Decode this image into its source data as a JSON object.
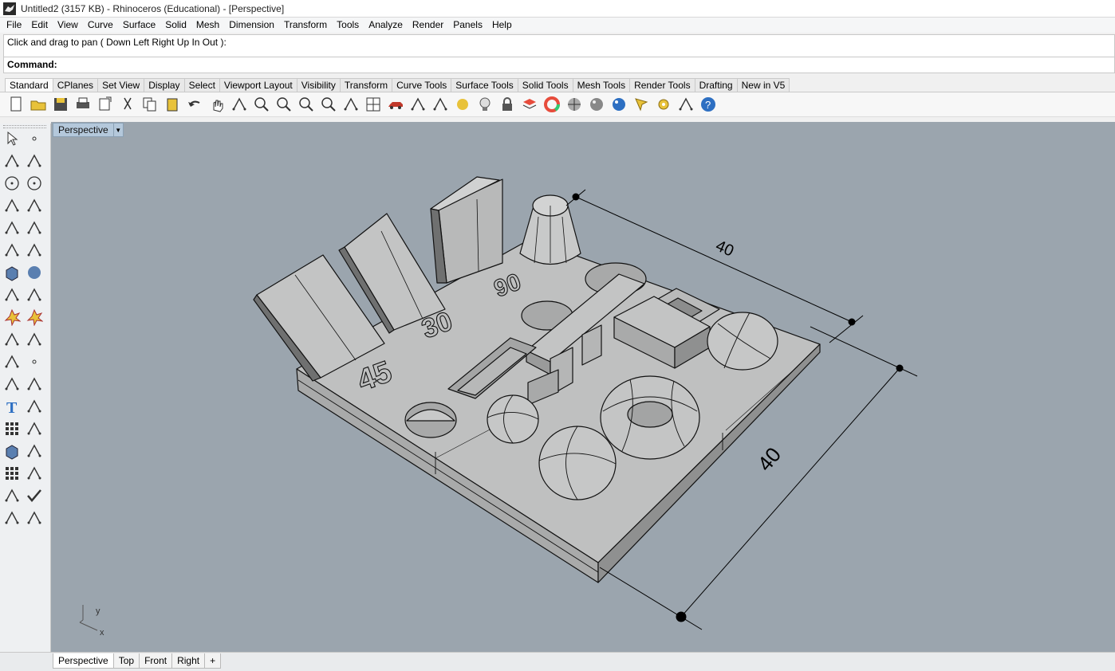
{
  "window": {
    "title": "Untitled2 (3157 KB) - Rhinoceros (Educational) - [Perspective]"
  },
  "menu": [
    "File",
    "Edit",
    "View",
    "Curve",
    "Surface",
    "Solid",
    "Mesh",
    "Dimension",
    "Transform",
    "Tools",
    "Analyze",
    "Render",
    "Panels",
    "Help"
  ],
  "command": {
    "history": "Click and drag to pan ( Down  Left  Right  Up  In  Out ):",
    "prompt": "Command:"
  },
  "toolbar_tabs": [
    "Standard",
    "CPlanes",
    "Set View",
    "Display",
    "Select",
    "Viewport Layout",
    "Visibility",
    "Transform",
    "Curve Tools",
    "Surface Tools",
    "Solid Tools",
    "Mesh Tools",
    "Render Tools",
    "Drafting",
    "New in V5"
  ],
  "toolbar_icons": [
    "new-icon",
    "open-icon",
    "save-icon",
    "print-icon",
    "import-icon",
    "cut-icon",
    "copy-icon",
    "paste-icon",
    "undo-icon",
    "pan-icon",
    "rotate-view-icon",
    "zoom-window-icon",
    "zoom-dynamic-icon",
    "zoom-extents-icon",
    "zoom-selected-icon",
    "undo-view-icon",
    "four-viewports-icon",
    "car-icon",
    "cplane-icon",
    "named-view-icon",
    "point-light-icon",
    "bulb-icon",
    "lock-icon",
    "layer-icon",
    "color-wheel-icon",
    "shaded-sphere-icon",
    "rendered-sphere-icon",
    "blue-sphere-icon",
    "render-icon",
    "options-gear-icon",
    "grasshopper-icon",
    "help-icon"
  ],
  "left_tools": [
    [
      "select-arrow-icon",
      "point-icon"
    ],
    [
      "polyline-icon",
      "curve-icon"
    ],
    [
      "circle-icon",
      "ellipse-icon"
    ],
    [
      "polygon-icon",
      "rectangle-icon"
    ],
    [
      "arc-icon",
      "fillet-curve-icon"
    ],
    [
      "surface-icon",
      "loft-icon"
    ],
    [
      "box-icon",
      "sphere-icon"
    ],
    [
      "extrude-icon",
      "mesh-icon"
    ],
    [
      "explode-icon",
      "split-icon"
    ],
    [
      "trim-icon",
      "join-icon"
    ],
    [
      "boolean-icon",
      "point-cloud-icon"
    ],
    [
      "offset-icon",
      "blend-icon"
    ],
    [
      "text-icon",
      "scale-icon"
    ],
    [
      "array-icon",
      "mirror-icon"
    ],
    [
      "box-edit-icon",
      "dimension-icon"
    ],
    [
      "grid-snap-icon",
      "gumball-icon"
    ],
    [
      "analyze-icon",
      "check-icon"
    ],
    [
      "render-mesh-icon",
      "paint-icon"
    ]
  ],
  "viewport": {
    "name": "Perspective",
    "labels": {
      "dim_top": "40",
      "dim_right": "40",
      "text_90": "90",
      "text_30": "30",
      "text_45": "45",
      "axis_x": "x",
      "axis_y": "y"
    }
  },
  "view_tabs": [
    "Perspective",
    "Top",
    "Front",
    "Right",
    "+"
  ],
  "colors": {
    "viewport_bg": "#9ba5ae",
    "model_face": "#bcbdbd",
    "model_edge": "#111111"
  }
}
